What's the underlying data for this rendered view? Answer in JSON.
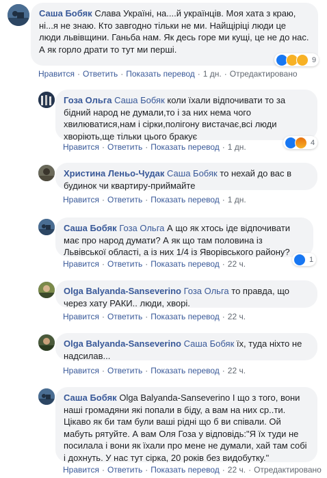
{
  "actions": {
    "like": "Нравится",
    "reply": "Ответить",
    "translate": "Показать перевод",
    "edited": "Отредактировано"
  },
  "colors": {
    "link": "#385898",
    "bubble": "#f2f3f5",
    "meta": "#606770"
  },
  "comments": [
    {
      "author": "Саша Бобяк",
      "text": "Слава Україні, на....й українців. Моя хата з краю, ні...я не знаю. Кто завгодно тільки не ми. Найщіріці люди це люди львівщини. Ганьба нам. Як десь горе ми кущі, це не до нас. А як горло драти то тут ми перші.",
      "time": "1 дн.",
      "reactions": {
        "icons": [
          "like-icon",
          "wow-icon",
          "sad-icon"
        ],
        "count": "9"
      }
    },
    {
      "author": "Гоза Ольга",
      "mention": "Саша Бобяк",
      "text": "коли їхали відпочивати то за бідний народ не думали,то і за них нема чого хвилюватися,нам і сірки,полігону вистачає,всі люди хворіють,ще тільки цього бракує",
      "time": "1 дн.",
      "reactions": {
        "icons": [
          "like-icon",
          "angry-icon"
        ],
        "count": "4"
      }
    },
    {
      "author": "Христина Леньо-Чудак",
      "mention": "Саша Бобяк",
      "text": "то нехай до вас в будинок чи квартиру-приймайте",
      "time": "1 дн."
    },
    {
      "author": "Саша Бобяк",
      "mention": "Гоза Ольга",
      "text": "А що як хтось іде відпочивати має про народ думати? А як що там половина із Львівської області, а із них 1/4 із Яворівського району?",
      "time": "22 ч.",
      "reactions": {
        "icons": [
          "like-icon"
        ],
        "count": "1"
      }
    },
    {
      "author": "Olga Balyanda-Sanseverino",
      "mention": "Гоза Ольга",
      "text": "то правда, що через хату РАКИ.. люди, хворі.",
      "time": "22 ч."
    },
    {
      "author": "Olga Balyanda-Sanseverino",
      "mention": "Саша Бобяк",
      "text": "їх, туда ніхто не надсилав...",
      "time": "22 ч."
    },
    {
      "author": "Саша Бобяк",
      "text": "Olga Balyanda-Sanseverino І що з того, вони наші громадяни які попали в біду, а вам на них ср..ти. Цікаво як би там були ваші рідні що б ви співали. Ой мабуть рятуйте. А вам Оля Гоза у відповідь:\"Я їх туди не посилала і вони як їхали про мене не думали, хай там собі і дохнуть. У нас тут сірка, 20 років без видобутку.\"",
      "time": "22 ч."
    }
  ]
}
